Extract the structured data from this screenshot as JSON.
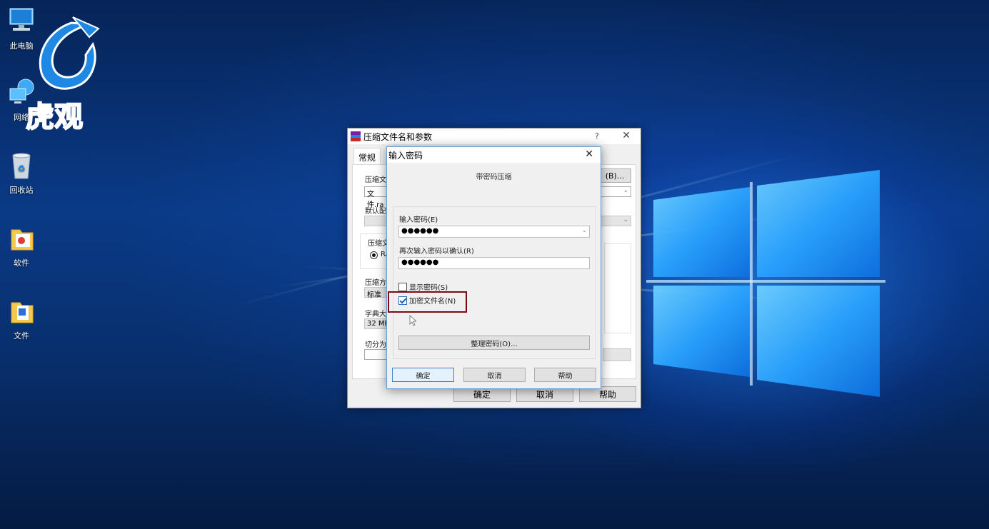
{
  "desktop": {
    "icons": [
      {
        "label": "此电脑",
        "icon": "computer-icon"
      },
      {
        "label": "网络",
        "icon": "network-icon"
      },
      {
        "label": "回收站",
        "icon": "recycle-bin-icon"
      },
      {
        "label": "软件",
        "icon": "folder-icon"
      },
      {
        "label": "文件",
        "icon": "folder-icon"
      }
    ],
    "watermark_text": "虎观"
  },
  "archive_dialog": {
    "title": "压缩文件名和参数",
    "help_glyph": "?",
    "close_glyph": "✕",
    "tab_general": "常规",
    "archive_name_label": "压缩文",
    "archive_name_value": "文件.ra",
    "browse_button": "(B)...",
    "profile_label": "默认配",
    "format_label": "压缩文",
    "format_option": "RA",
    "method_label": "压缩方",
    "method_value": "标准",
    "dict_label": "字典大",
    "dict_value": "32 MB",
    "split_label": "切分为",
    "ok_button": "确定",
    "cancel_button": "取消",
    "help_button": "帮助"
  },
  "password_dialog": {
    "title": "输入密码",
    "close_glyph": "✕",
    "subtitle": "带密码压缩",
    "enter_label": "输入密码(E)",
    "enter_value": "●●●●●●",
    "confirm_label": "再次输入密码以确认(R)",
    "confirm_value": "●●●●●●",
    "show_password": {
      "label": "显示密码(S)",
      "checked": false
    },
    "encrypt_names": {
      "label": "加密文件名(N)",
      "checked": true
    },
    "organize_button": "整理密码(O)...",
    "ok_button": "确定",
    "cancel_button": "取消",
    "help_button": "帮助"
  },
  "colors": {
    "highlight_box": "#7a0d0d",
    "accent": "#3c7fd1"
  }
}
